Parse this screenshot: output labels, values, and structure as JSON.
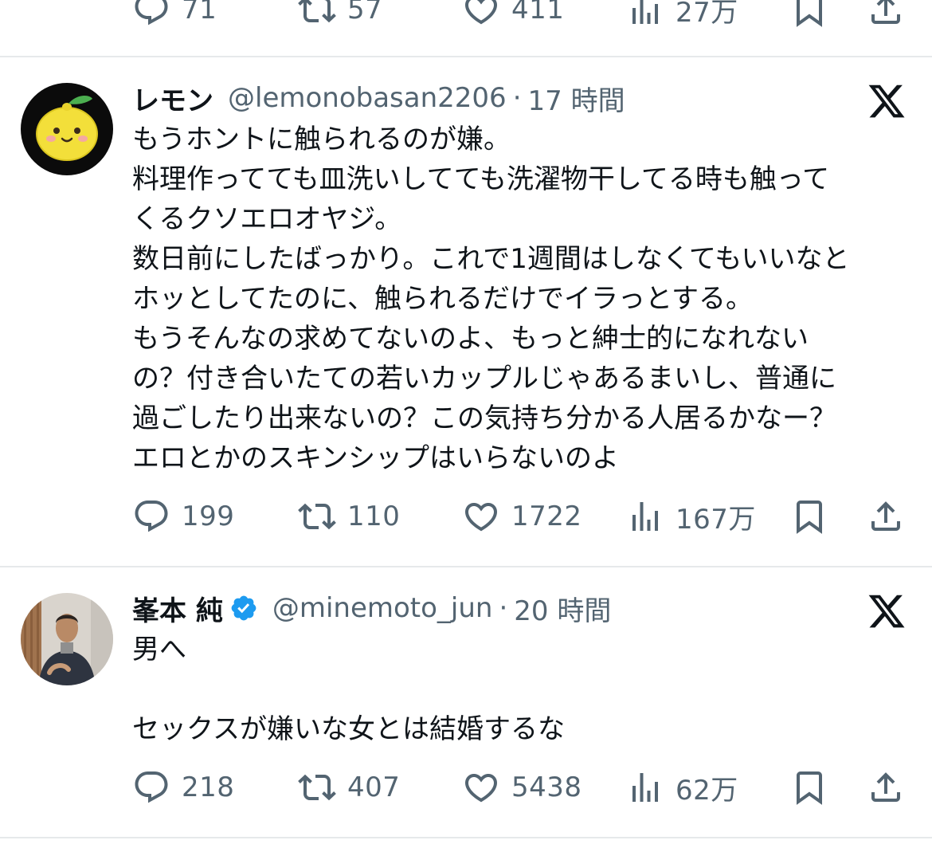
{
  "icons": {
    "reply": "reply-icon",
    "retweet": "retweet-icon",
    "like": "heart-icon",
    "views": "views-icon",
    "bookmark": "bookmark-icon",
    "share": "share-icon",
    "brand": "x-logo-icon"
  },
  "colors": {
    "text": "#0f1419",
    "muted": "#536471",
    "divider": "#e6e9eb",
    "verified": "#1d9bf0"
  },
  "top_actions": {
    "replies": "71",
    "retweets": "57",
    "likes": "411",
    "views": "27万"
  },
  "tweets": [
    {
      "display_name": "レモン",
      "handle": "@lemonobasan2206",
      "separator": "·",
      "time_ago": "17 時間",
      "verified": false,
      "lines": [
        "もうホントに触られるのが嫌。",
        "料理作ってても皿洗いしてても洗濯物干してる時も触って",
        "くるクソエロオヤジ。",
        "数日前にしたばっかり。これで1週間はしなくてもいいなと",
        "ホッとしてたのに、触られるだけでイラっとする。",
        "もうそんなの求めてないのよ、もっと紳士的になれない",
        "の？付き合いたての若いカップルじゃあるまいし、普通に",
        "過ごしたり出来ないの？この気持ち分かる人居るかなー？",
        "エロとかのスキンシップはいらないのよ"
      ],
      "replies": "199",
      "retweets": "110",
      "likes": "1722",
      "views": "167万"
    },
    {
      "display_name": "峯本 純",
      "handle": "@minemoto_jun",
      "separator": "·",
      "time_ago": "20 時間",
      "verified": true,
      "lines": [
        "男へ",
        "",
        "セックスが嫌いな女とは結婚するな"
      ],
      "replies": "218",
      "retweets": "407",
      "likes": "5438",
      "views": "62万"
    }
  ]
}
